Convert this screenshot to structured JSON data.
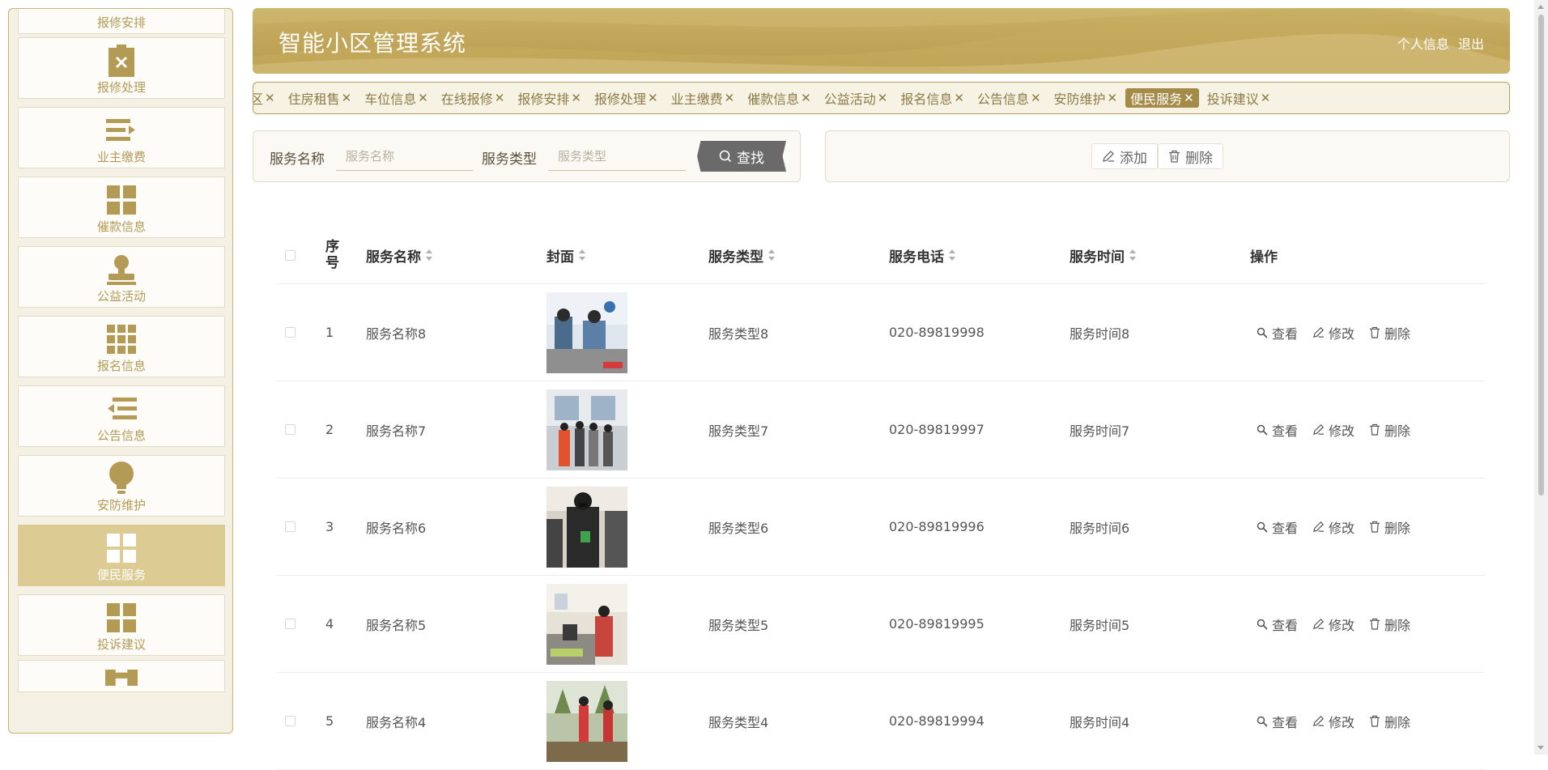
{
  "app": {
    "title": "智能小区管理系统",
    "user_info": "个人信息",
    "logout": "退出",
    "accent": "#b89b4d",
    "active_bg": "#dccb93"
  },
  "sidebar": {
    "items": [
      {
        "label": "报修安排",
        "icon": "repair-plan-icon"
      },
      {
        "label": "报修处理",
        "icon": "clipboard-x-icon"
      },
      {
        "label": "业主缴费",
        "icon": "list-arrow-icon"
      },
      {
        "label": "催款信息",
        "icon": "grid-icon"
      },
      {
        "label": "公益活动",
        "icon": "stamp-icon"
      },
      {
        "label": "报名信息",
        "icon": "grid-nine-icon"
      },
      {
        "label": "公告信息",
        "icon": "indent-icon"
      },
      {
        "label": "安防维护",
        "icon": "bulb-icon"
      },
      {
        "label": "便民服务",
        "icon": "grid-icon",
        "active": true
      },
      {
        "label": "投诉建议",
        "icon": "grid-icon"
      },
      {
        "label": "",
        "icon": "bridge-icon"
      }
    ]
  },
  "tabs": [
    {
      "label": "住房租售"
    },
    {
      "label": "车位信息"
    },
    {
      "label": "在线报修"
    },
    {
      "label": "报修安排"
    },
    {
      "label": "报修处理"
    },
    {
      "label": "业主缴费"
    },
    {
      "label": "催款信息"
    },
    {
      "label": "公益活动"
    },
    {
      "label": "报名信息"
    },
    {
      "label": "公告信息"
    },
    {
      "label": "安防维护"
    },
    {
      "label": "便民服务",
      "active": true
    },
    {
      "label": "投诉建议"
    }
  ],
  "search": {
    "name_label": "服务名称",
    "name_placeholder": "服务名称",
    "type_label": "服务类型",
    "type_placeholder": "服务类型",
    "button": "查找"
  },
  "actions": {
    "add": "添加",
    "delete": "删除"
  },
  "table": {
    "headers": {
      "index": "序号",
      "name": "服务名称",
      "cover": "封面",
      "type": "服务类型",
      "phone": "服务电话",
      "time": "服务时间",
      "ops": "操作"
    },
    "row_actions": {
      "view": "查看",
      "edit": "修改",
      "delete": "删除"
    },
    "rows": [
      {
        "index": "1",
        "name": "服务名称8",
        "type": "服务类型8",
        "phone": "020-89819998",
        "time": "服务时间8"
      },
      {
        "index": "2",
        "name": "服务名称7",
        "type": "服务类型7",
        "phone": "020-89819997",
        "time": "服务时间7"
      },
      {
        "index": "3",
        "name": "服务名称6",
        "type": "服务类型6",
        "phone": "020-89819996",
        "time": "服务时间6"
      },
      {
        "index": "4",
        "name": "服务名称5",
        "type": "服务类型5",
        "phone": "020-89819995",
        "time": "服务时间5"
      },
      {
        "index": "5",
        "name": "服务名称4",
        "type": "服务类型4",
        "phone": "020-89819994",
        "time": "服务时间4"
      }
    ]
  }
}
